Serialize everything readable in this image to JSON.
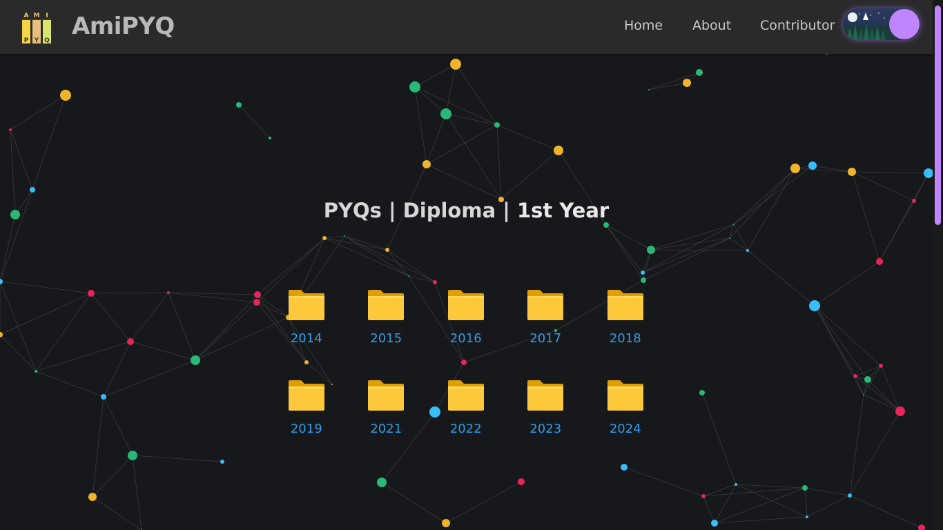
{
  "brand": {
    "name": "AmiPYQ",
    "logo_letters": [
      "A",
      "M",
      "I",
      "P",
      "Y",
      "Q"
    ]
  },
  "nav": {
    "links": [
      "Home",
      "About",
      "Contributor"
    ]
  },
  "theme_toggle": {
    "state": "dark"
  },
  "heading": {
    "part1": "PYQs | Diploma | ",
    "part2": "1st Year"
  },
  "folders": [
    {
      "label": "2014"
    },
    {
      "label": "2015"
    },
    {
      "label": "2016"
    },
    {
      "label": "2017"
    },
    {
      "label": "2018"
    },
    {
      "label": "2019"
    },
    {
      "label": "2021"
    },
    {
      "label": "2022"
    },
    {
      "label": "2023"
    },
    {
      "label": "2024"
    }
  ],
  "colors": {
    "background": "#16181b",
    "navbar": "#2a2a2b",
    "accent": "#c084fc",
    "folder_label": "#2d9ee8",
    "particle_yellow": "#f0b429",
    "particle_green": "#28b878",
    "particle_blue": "#38bdf8",
    "particle_red": "#e8245a"
  }
}
